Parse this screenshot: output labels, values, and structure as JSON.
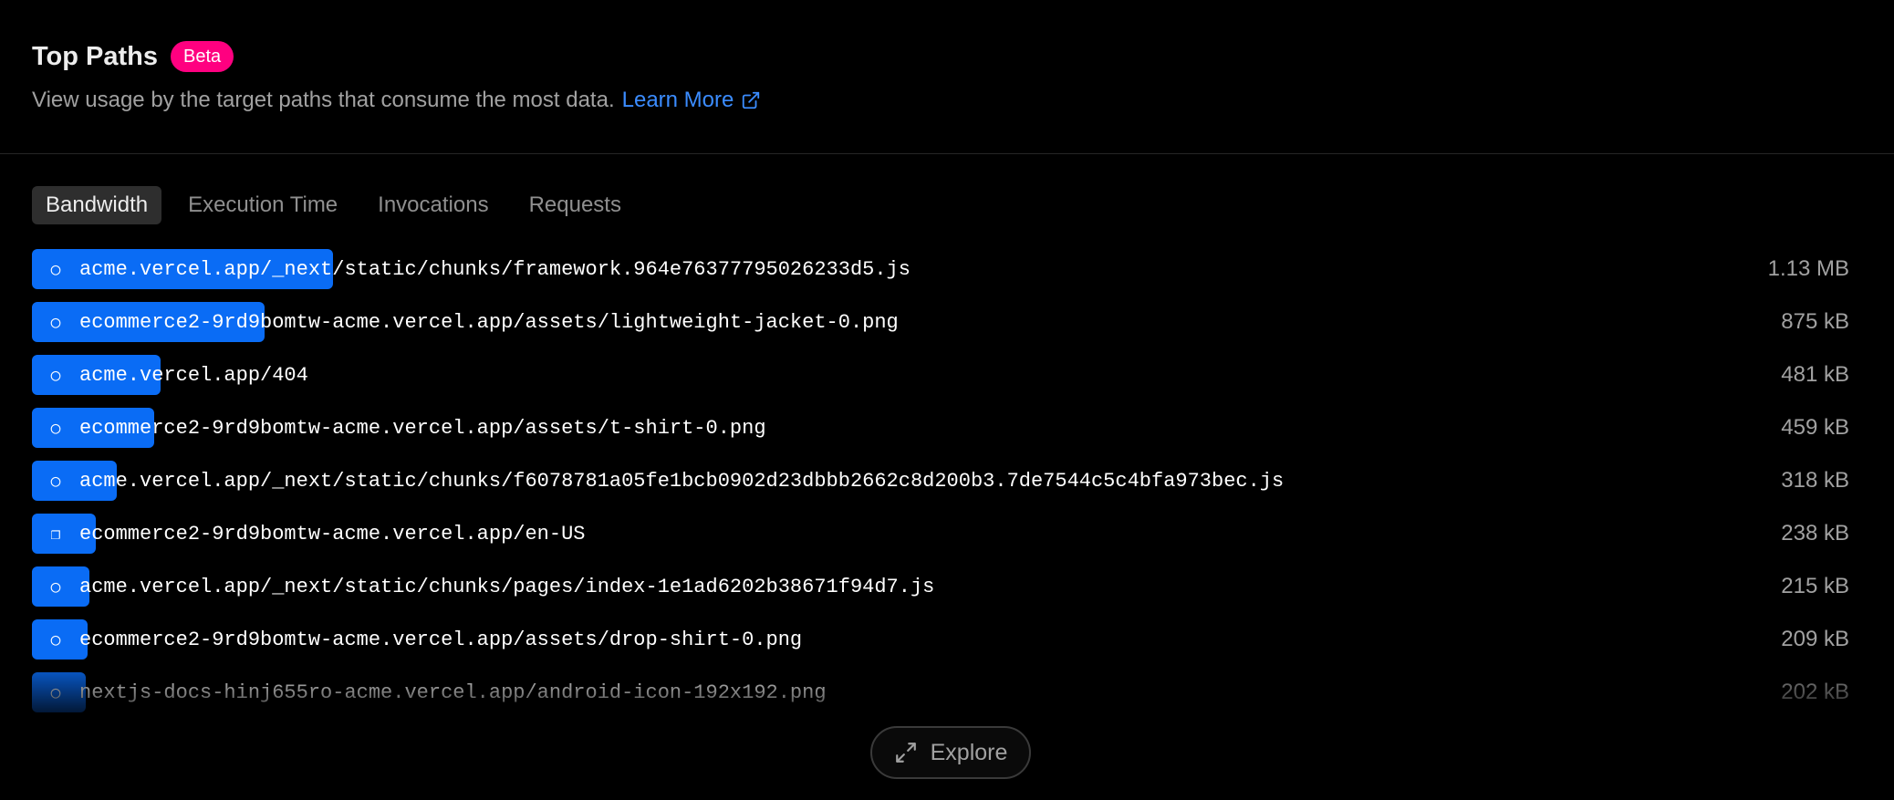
{
  "header": {
    "title": "Top Paths",
    "badge": "Beta",
    "description": "View usage by the target paths that consume the most data.",
    "learn_more": "Learn More"
  },
  "tabs": [
    {
      "label": "Bandwidth",
      "active": true
    },
    {
      "label": "Execution Time",
      "active": false
    },
    {
      "label": "Invocations",
      "active": false
    },
    {
      "label": "Requests",
      "active": false
    }
  ],
  "rows": [
    {
      "icon": "○",
      "path": "acme.vercel.app/_next/static/chunks/framework.964e76377795026233d5.js",
      "value": "1.13 MB",
      "fraction": 1.0
    },
    {
      "icon": "○",
      "path": "ecommerce2-9rd9bomtw-acme.vercel.app/assets/lightweight-jacket-0.png",
      "value": "875 kB",
      "fraction": 0.774
    },
    {
      "icon": "○",
      "path": "acme.vercel.app/404",
      "value": "481 kB",
      "fraction": 0.426
    },
    {
      "icon": "○",
      "path": "ecommerce2-9rd9bomtw-acme.vercel.app/assets/t-shirt-0.png",
      "value": "459 kB",
      "fraction": 0.406
    },
    {
      "icon": "○",
      "path": "acme.vercel.app/_next/static/chunks/f6078781a05fe1bcb0902d23dbbb2662c8d200b3.7de7544c5c4bfa973bec.js",
      "value": "318 kB",
      "fraction": 0.281
    },
    {
      "icon": "❐",
      "path": "ecommerce2-9rd9bomtw-acme.vercel.app/en-US",
      "value": "238 kB",
      "fraction": 0.211
    },
    {
      "icon": "○",
      "path": "acme.vercel.app/_next/static/chunks/pages/index-1e1ad6202b38671f94d7.js",
      "value": "215 kB",
      "fraction": 0.19
    },
    {
      "icon": "○",
      "path": "ecommerce2-9rd9bomtw-acme.vercel.app/assets/drop-shirt-0.png",
      "value": "209 kB",
      "fraction": 0.185
    },
    {
      "icon": "○",
      "path": "nextjs-docs-hinj655ro-acme.vercel.app/android-icon-192x192.png",
      "value": "202 kB",
      "fraction": 0.179
    }
  ],
  "explore_button": "Explore",
  "colors": {
    "accent_bar": "#0a6cf5",
    "badge": "#ff0080",
    "link": "#3b8cff"
  }
}
